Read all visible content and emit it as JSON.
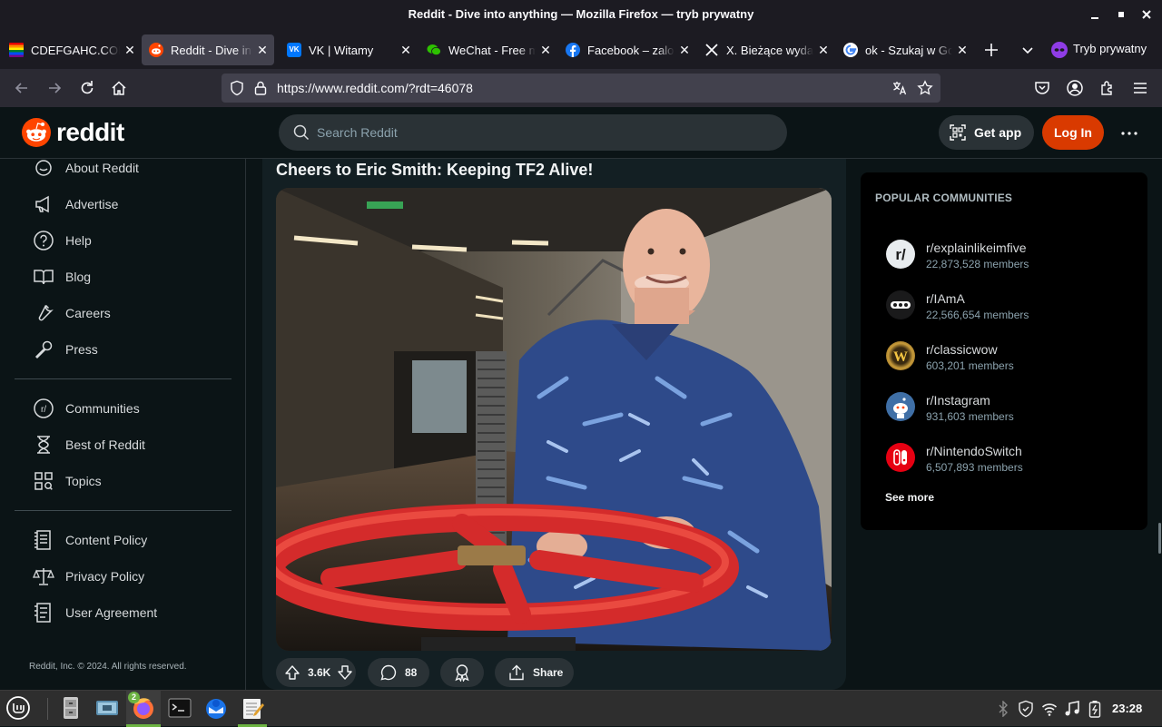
{
  "window": {
    "title": "Reddit - Dive into anything — Mozilla Firefox — tryb prywatny"
  },
  "tabs": [
    {
      "label": "CDEFGAHC.COM",
      "icon": "rainbow-flag-favicon"
    },
    {
      "label": "Reddit - Dive into anything",
      "icon": "reddit-favicon",
      "active": true
    },
    {
      "label": "VK | Witamy",
      "icon": "vk-favicon"
    },
    {
      "label": "WeChat - Free messaging",
      "icon": "wechat-favicon"
    },
    {
      "label": "Facebook – zaloguj się",
      "icon": "facebook-favicon"
    },
    {
      "label": "X. Bieżące wydarzenia",
      "icon": "x-favicon"
    },
    {
      "label": "ok - Szukaj w Google",
      "icon": "google-favicon"
    }
  ],
  "private_label": "Tryb prywatny",
  "address_bar": {
    "url": "https://www.reddit.com/?rdt=46078"
  },
  "reddit": {
    "logo_text": "reddit",
    "search_placeholder": "Search Reddit",
    "get_app": "Get app",
    "login": "Log In"
  },
  "sidebar": {
    "group1": [
      {
        "label": "About Reddit",
        "icon": "about-icon"
      },
      {
        "label": "Advertise",
        "icon": "megaphone-icon"
      },
      {
        "label": "Help",
        "icon": "help-icon"
      },
      {
        "label": "Blog",
        "icon": "book-icon"
      },
      {
        "label": "Careers",
        "icon": "wrench-icon"
      },
      {
        "label": "Press",
        "icon": "microphone-icon"
      }
    ],
    "group2": [
      {
        "label": "Communities",
        "icon": "communities-icon"
      },
      {
        "label": "Best of Reddit",
        "icon": "hourglass-icon"
      },
      {
        "label": "Topics",
        "icon": "topics-icon"
      }
    ],
    "group3": [
      {
        "label": "Content Policy",
        "icon": "content-policy-icon"
      },
      {
        "label": "Privacy Policy",
        "icon": "scales-icon"
      },
      {
        "label": "User Agreement",
        "icon": "document-icon"
      }
    ],
    "copyright": "Reddit, Inc. © 2024. All rights reserved."
  },
  "post": {
    "title": "Cheers to Eric Smith: Keeping TF2 Alive!",
    "score": "3.6K",
    "comments": "88",
    "share": "Share"
  },
  "popular": {
    "heading": "POPULAR COMMUNITIES",
    "items": [
      {
        "name": "r/explainlikeimfive",
        "members": "22,873,528 members"
      },
      {
        "name": "r/IAmA",
        "members": "22,566,654 members"
      },
      {
        "name": "r/classicwow",
        "members": "603,201 members"
      },
      {
        "name": "r/Instagram",
        "members": "931,603 members"
      },
      {
        "name": "r/NintendoSwitch",
        "members": "6,507,893 members"
      }
    ],
    "see_more": "See more"
  },
  "taskbar": {
    "clock": "23:28",
    "firefox_badge": "2"
  },
  "colors": {
    "accent": "#d93a00",
    "bg": "#0b1416",
    "card": "#131f23",
    "chip": "#2a3236"
  }
}
